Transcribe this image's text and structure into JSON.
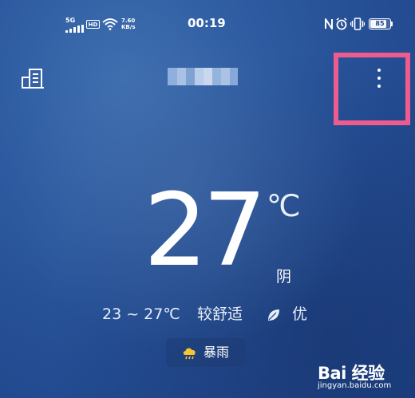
{
  "status_bar": {
    "network": "5G",
    "hd": "HD",
    "speed_value": "7.60",
    "speed_unit": "KB/s",
    "time": "00:19",
    "battery": "85",
    "battery_level": 0.85
  },
  "header": {
    "location_blurred": true
  },
  "weather": {
    "temperature": "27",
    "unit": "℃",
    "condition": "阴",
    "range": "23 ~ 27℃",
    "comfort": "较舒适",
    "air_quality": "优",
    "alert": "暴雨"
  },
  "watermark": {
    "brand": "Bai 经验",
    "url": "jingyan.baidu.com"
  },
  "colors": {
    "highlight_border": "#ee5b8d",
    "alert_icon": "#f7c531"
  }
}
